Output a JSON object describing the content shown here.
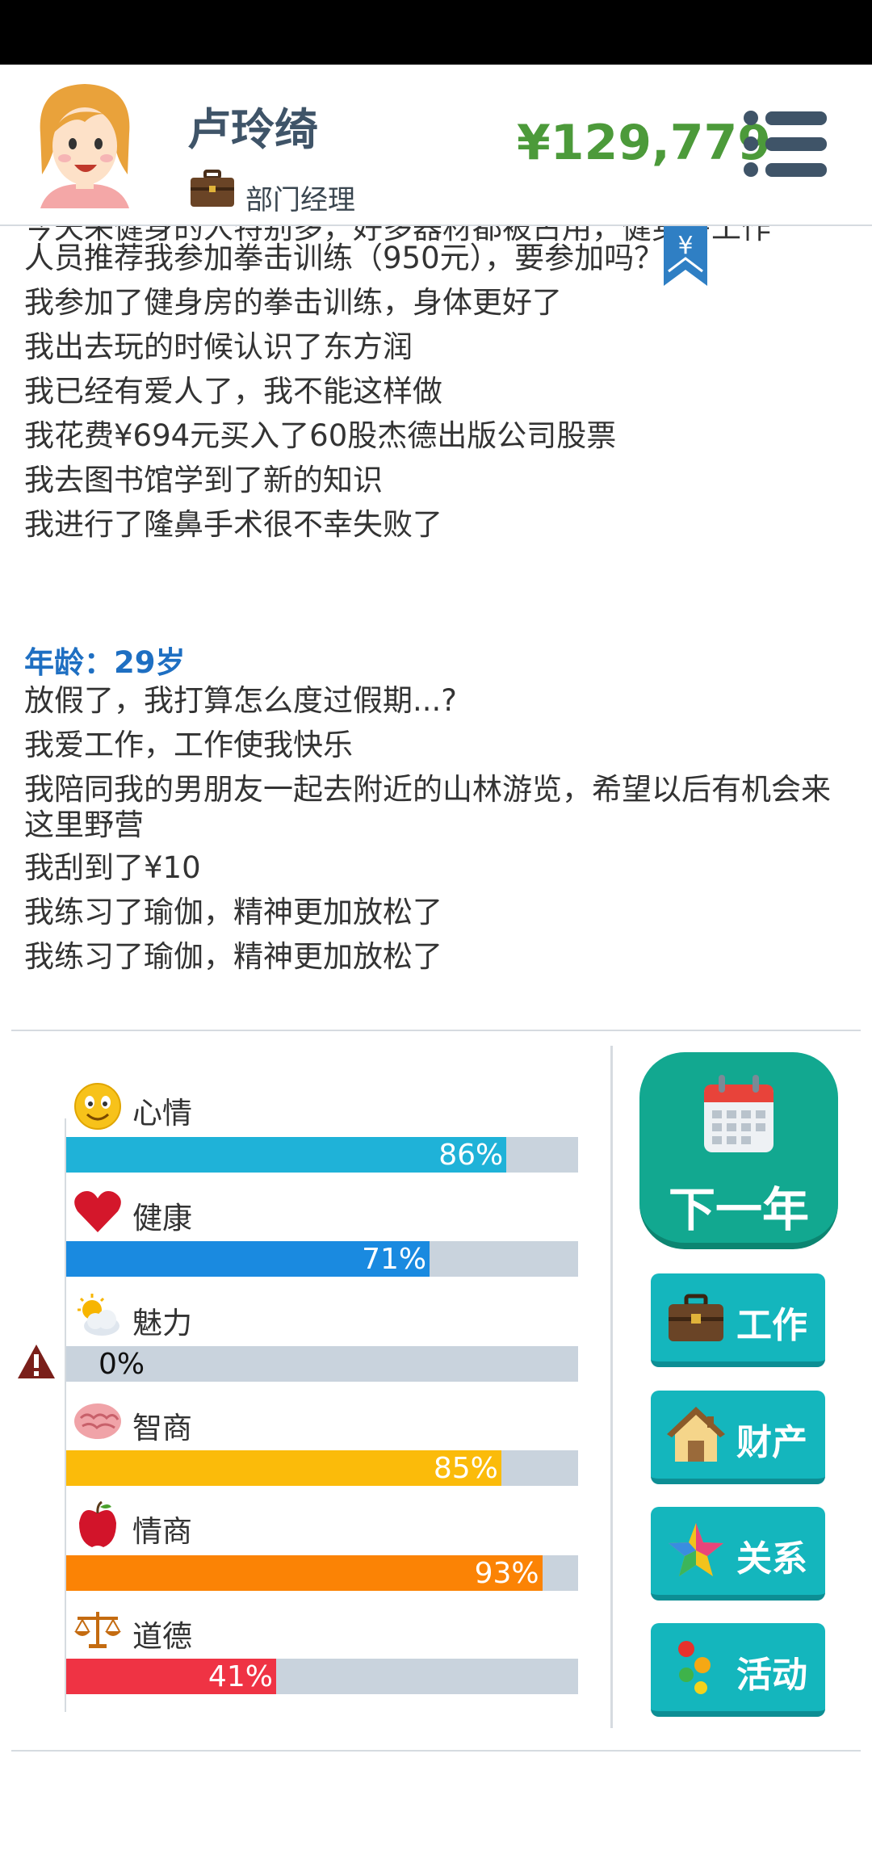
{
  "profile": {
    "name": "卢玲绮",
    "job": "部门经理",
    "money": "¥129,779"
  },
  "log": {
    "cut_line": "今天来健身的人特别多，好多器材都被占用，健身房工作",
    "lines_top": [
      "人员推荐我参加拳击训练（950元），要参加吗？",
      "我参加了健身房的拳击训练，身体更好了",
      "我出去玩的时候认识了东方润",
      "我已经有爱人了，我不能这样做",
      "我花费¥694元买入了60股杰德出版公司股票",
      "我去图书馆学到了新的知识",
      "我进行了隆鼻手术很不幸失败了"
    ],
    "age_label": "年龄：29岁",
    "lines_age": [
      "放假了，我打算怎么度过假期...?",
      "我爱工作，工作使我快乐",
      "我陪同我的男朋友一起去附近的山林游览，希望以后有机会来这里野营",
      "我刮到了¥10",
      "我练习了瑜伽，精神更加放松了",
      "我练习了瑜伽，精神更加放松了"
    ],
    "bookmark_symbol": "¥"
  },
  "stats": [
    {
      "label": "心情",
      "value": 86,
      "text": "86%",
      "color": "#1fb2d8",
      "icon": "smiley-icon"
    },
    {
      "label": "健康",
      "value": 71,
      "text": "71%",
      "color": "#1a8ae0",
      "icon": "heart-icon"
    },
    {
      "label": "魅力",
      "value": 0,
      "text": "0%",
      "color": "#c9d3dd",
      "icon": "sun-cloud-icon"
    },
    {
      "label": "智商",
      "value": 85,
      "text": "85%",
      "color": "#fbbb0a",
      "icon": "brain-icon"
    },
    {
      "label": "情商",
      "value": 93,
      "text": "93%",
      "color": "#fb8305",
      "icon": "apple-icon"
    },
    {
      "label": "道德",
      "value": 41,
      "text": "41%",
      "color": "#ef3344",
      "icon": "scale-icon"
    }
  ],
  "actions": {
    "next_year": "下一年",
    "work": "工作",
    "assets": "财产",
    "relations": "关系",
    "activities": "活动"
  }
}
